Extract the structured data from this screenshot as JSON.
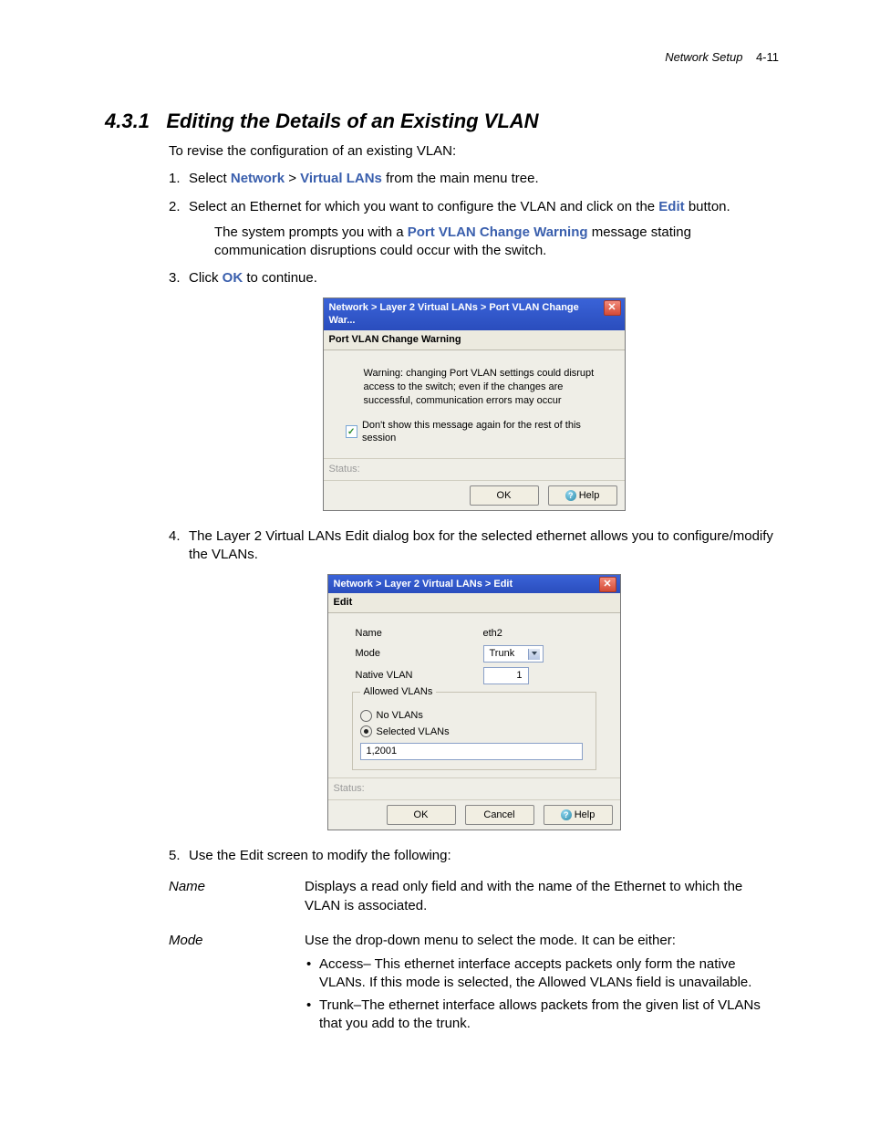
{
  "header": {
    "chapter": "Network Setup",
    "page": "4-11"
  },
  "section": {
    "num": "4.3.1",
    "title": "Editing the Details of an Existing VLAN"
  },
  "intro": "To revise the configuration of an existing VLAN:",
  "steps": {
    "s1a": "Select ",
    "s1_nav1": "Network",
    "s1_gt": " > ",
    "s1_nav2": "Virtual LANs",
    "s1b": " from the main menu tree.",
    "s2a": "Select an Ethernet for which you want to configure the VLAN and click on the ",
    "s2_btn": "Edit",
    "s2b": " button.",
    "s2p_a": "The system prompts you with a ",
    "s2p_bold": "Port VLAN Change Warning",
    "s2p_b": " message stating communication disruptions could occur with the switch.",
    "s3a": "Click ",
    "s3_bold": "OK",
    "s3b": " to continue.",
    "s4": "The Layer 2 Virtual LANs Edit dialog box for the selected ethernet allows you to configure/modify the VLANs.",
    "s5": "Use the Edit screen to modify the following:"
  },
  "dlg1": {
    "title": "Network > Layer 2 Virtual LANs > Port VLAN Change War...",
    "panel": "Port VLAN Change Warning",
    "warn": "Warning: changing Port VLAN settings could disrupt access to the switch; even if the changes are successful, communication errors may occur",
    "dontshow": "Don't show this message again for the rest of this session",
    "status": "Status:",
    "ok": "OK",
    "help": "Help"
  },
  "dlg2": {
    "title": "Network > Layer 2 Virtual LANs > Edit",
    "panel": "Edit",
    "name_lab": "Name",
    "name_val": "eth2",
    "mode_lab": "Mode",
    "mode_val": "Trunk",
    "native_lab": "Native VLAN",
    "native_val": "1",
    "allowed_legend": "Allowed VLANs",
    "novlans": "No VLANs",
    "selvlans": "Selected VLANs",
    "sel_val": "1,2001",
    "status": "Status:",
    "ok": "OK",
    "cancel": "Cancel",
    "help": "Help"
  },
  "desc": {
    "name_k": "Name",
    "name_v": "Displays a read only field and with the name of the Ethernet to which the VLAN is associated.",
    "mode_k": "Mode",
    "mode_v": "Use the drop-down menu to select the mode. It can be either:",
    "mode_b1": "Access– This ethernet interface accepts packets only form the native VLANs. If this mode is selected, the Allowed VLANs field is unavailable.",
    "mode_b2": "Trunk–The ethernet interface allows packets from the given list of VLANs that you add to the trunk."
  }
}
